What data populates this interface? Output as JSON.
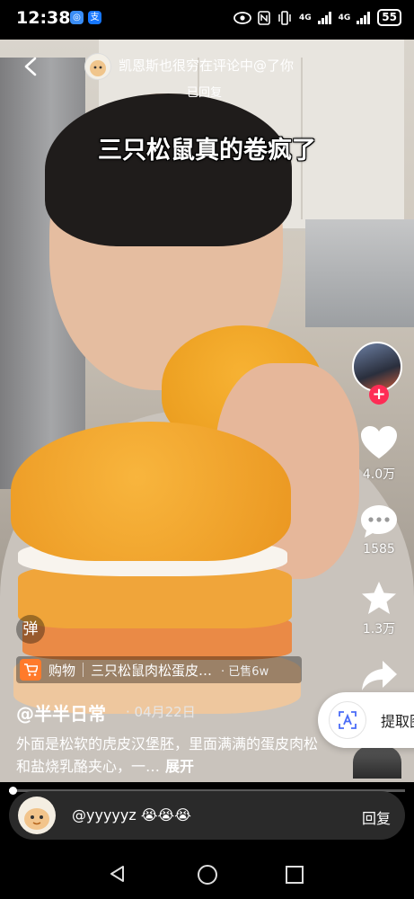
{
  "status_bar": {
    "time": "12:38",
    "app_badge_1": "◎",
    "app_badge_2": "支",
    "network_1": "4G",
    "network_2": "4G",
    "battery": "55"
  },
  "top_bar": {
    "text": "凯恩斯也很穷在评论中@了你",
    "replied": "已回复"
  },
  "video": {
    "caption": "三只松鼠真的卷疯了"
  },
  "side_rail": {
    "like_count": "4.0万",
    "comment_count": "1585",
    "favorite_count": "1.3万"
  },
  "danmaku": {
    "label": "弹"
  },
  "shopping": {
    "label": "购物",
    "title": "三只松鼠肉松蛋皮…",
    "sold": "· 已售6w"
  },
  "post": {
    "author": "@半半日常",
    "date": "· 04月22日",
    "description": "外面是松软的虎皮汉堡胚，里面满满的蛋皮肉松和盐烧乳酪夹心，一…",
    "expand": "展开"
  },
  "extract": {
    "label": "提取图"
  },
  "progress": {
    "fraction": 0.005
  },
  "comment_bar": {
    "text": "@yyyyyz 😭😭😭",
    "reply": "回复"
  }
}
